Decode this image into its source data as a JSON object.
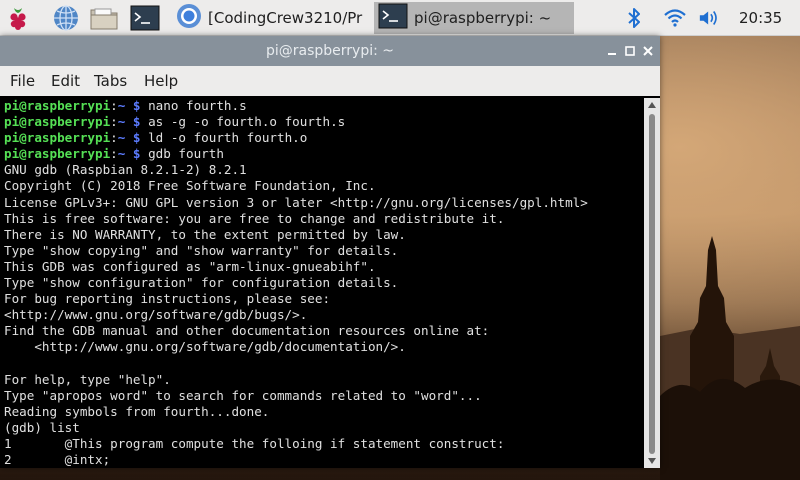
{
  "taskbar": {
    "launchers": [
      {
        "icon": "raspberry-menu-icon"
      },
      {
        "icon": "web-browser-icon"
      },
      {
        "icon": "file-manager-icon"
      },
      {
        "icon": "terminal-icon"
      }
    ],
    "tasks": [
      {
        "label": "[CodingCrew3210/Pr",
        "icon": "chromium-icon",
        "active": false
      },
      {
        "label": "pi@raspberrypi: ~",
        "icon": "terminal-icon",
        "active": true
      }
    ],
    "tray": {
      "bluetooth_icon": "bluetooth-icon",
      "wifi_icon": "wifi-icon",
      "volume_icon": "volume-icon",
      "clock": "20:35"
    }
  },
  "window": {
    "title": "pi@raspberrypi: ~",
    "menu": [
      "File",
      "Edit",
      "Tabs",
      "Help"
    ],
    "prompt": {
      "user": "pi@raspberrypi",
      "sep": ":",
      "path": "~",
      "symbol": " $ "
    },
    "lines": [
      {
        "type": "prompt",
        "cmd": "nano fourth.s"
      },
      {
        "type": "prompt",
        "cmd": "as -g -o fourth.o fourth.s"
      },
      {
        "type": "prompt",
        "cmd": "ld -o fourth fourth.o"
      },
      {
        "type": "prompt",
        "cmd": "gdb fourth"
      },
      {
        "type": "out",
        "text": "GNU gdb (Raspbian 8.2.1-2) 8.2.1"
      },
      {
        "type": "out",
        "text": "Copyright (C) 2018 Free Software Foundation, Inc."
      },
      {
        "type": "out",
        "text": "License GPLv3+: GNU GPL version 3 or later <http://gnu.org/licenses/gpl.html>"
      },
      {
        "type": "out",
        "text": "This is free software: you are free to change and redistribute it."
      },
      {
        "type": "out",
        "text": "There is NO WARRANTY, to the extent permitted by law."
      },
      {
        "type": "out",
        "text": "Type \"show copying\" and \"show warranty\" for details."
      },
      {
        "type": "out",
        "text": "This GDB was configured as \"arm-linux-gnueabihf\"."
      },
      {
        "type": "out",
        "text": "Type \"show configuration\" for configuration details."
      },
      {
        "type": "out",
        "text": "For bug reporting instructions, please see:"
      },
      {
        "type": "out",
        "text": "<http://www.gnu.org/software/gdb/bugs/>."
      },
      {
        "type": "out",
        "text": "Find the GDB manual and other documentation resources online at:"
      },
      {
        "type": "out",
        "text": "    <http://www.gnu.org/software/gdb/documentation/>."
      },
      {
        "type": "out",
        "text": ""
      },
      {
        "type": "out",
        "text": "For help, type \"help\"."
      },
      {
        "type": "out",
        "text": "Type \"apropos word\" to search for commands related to \"word\"..."
      },
      {
        "type": "out",
        "text": "Reading symbols from fourth...done."
      },
      {
        "type": "out",
        "text": "(gdb) list"
      },
      {
        "type": "out",
        "text": "1       @This program compute the folloing if statement construct:"
      },
      {
        "type": "out",
        "text": "2       @intx;"
      }
    ]
  },
  "colors": {
    "prompt_user": "#55e055",
    "prompt_path": "#5c7cff",
    "titlebar": "#87919b",
    "taskbar": "#edeceb"
  }
}
